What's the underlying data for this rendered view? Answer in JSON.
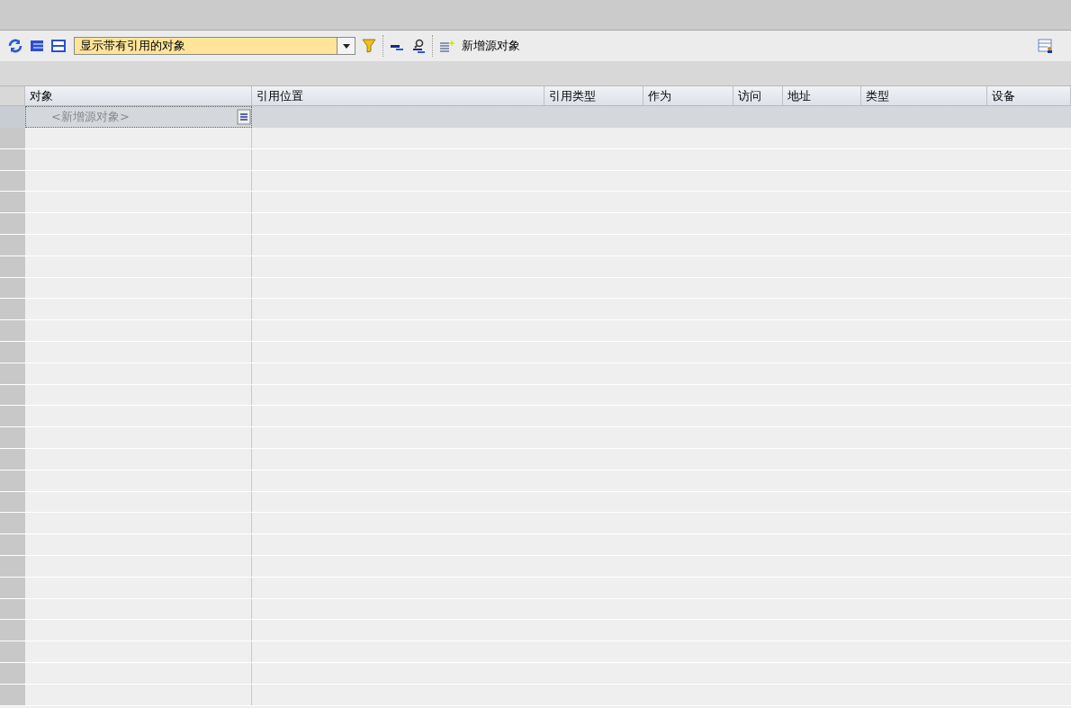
{
  "toolbar": {
    "filter": {
      "value": "显示带有引用的对象"
    },
    "add_source_button": "新增源对象"
  },
  "table": {
    "columns": [
      "对象",
      "引用位置",
      "引用类型",
      "作为",
      "访问",
      "地址",
      "类型",
      "设备"
    ],
    "rows": [
      {
        "object": "<新增源对象>",
        "selected": true
      }
    ]
  }
}
